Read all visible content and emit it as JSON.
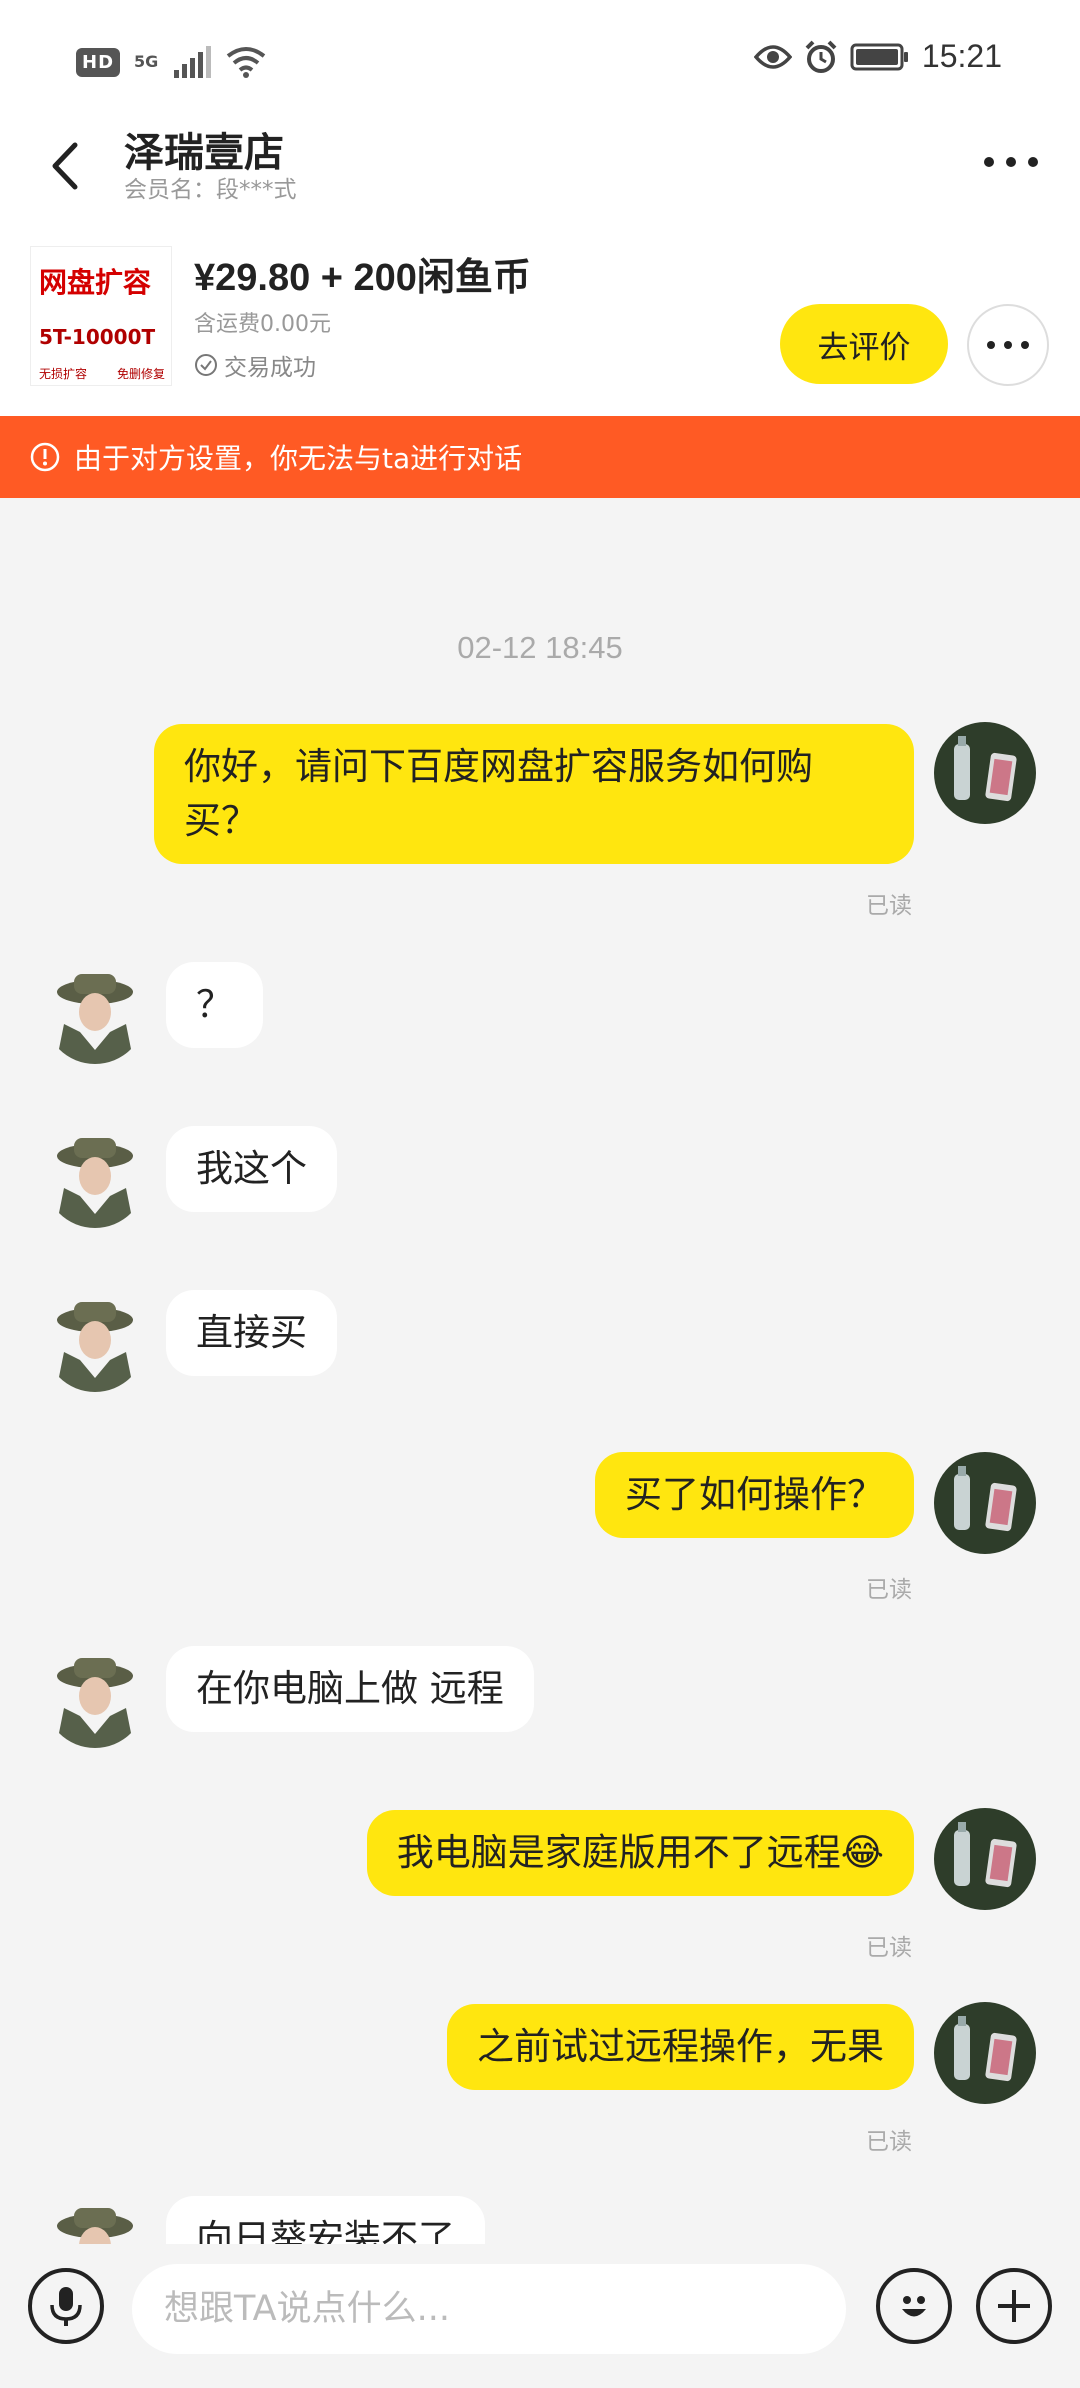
{
  "status_bar": {
    "hd": "HD",
    "network": "5G",
    "time": "15:21",
    "icons": [
      "signal-icon",
      "wifi-icon",
      "eye-icon",
      "alarm-icon",
      "battery-icon"
    ]
  },
  "header": {
    "title": "泽瑞壹店",
    "member": "会员名：段***式"
  },
  "order": {
    "thumb_line1": "网盘扩容",
    "thumb_line2": "5T-10000T",
    "thumb_tag1": "无损扩容",
    "thumb_tag2": "免删修复",
    "price": "¥29.80 + 200闲鱼币",
    "shipping": "含运费0.00元",
    "status": "交易成功",
    "review_button": "去评价"
  },
  "warning": {
    "text": "由于对方设置，你无法与ta进行对话"
  },
  "chat": {
    "timestamp": "02-12 18:45",
    "messages": [
      {
        "side": "me",
        "text": "你好，请问下百度网盘扩容服务如何购买？",
        "read": "已读"
      },
      {
        "side": "other",
        "text": "？"
      },
      {
        "side": "other",
        "text": "我这个"
      },
      {
        "side": "other",
        "text": "直接买"
      },
      {
        "side": "me",
        "text": "买了如何操作？",
        "read": "已读"
      },
      {
        "side": "other",
        "text": "在你电脑上做 远程"
      },
      {
        "side": "me",
        "text": "我电脑是家庭版用不了远程😂",
        "read": "已读"
      },
      {
        "side": "me",
        "text": "之前试过远程操作，无果",
        "read": "已读"
      },
      {
        "side": "other",
        "text": "向日葵安装不了"
      }
    ]
  },
  "input": {
    "placeholder": "想跟TA说点什么..."
  },
  "colors": {
    "accent_yellow": "#ffe60f",
    "warning_orange": "#ff5a24",
    "background": "#f4f4f4"
  }
}
